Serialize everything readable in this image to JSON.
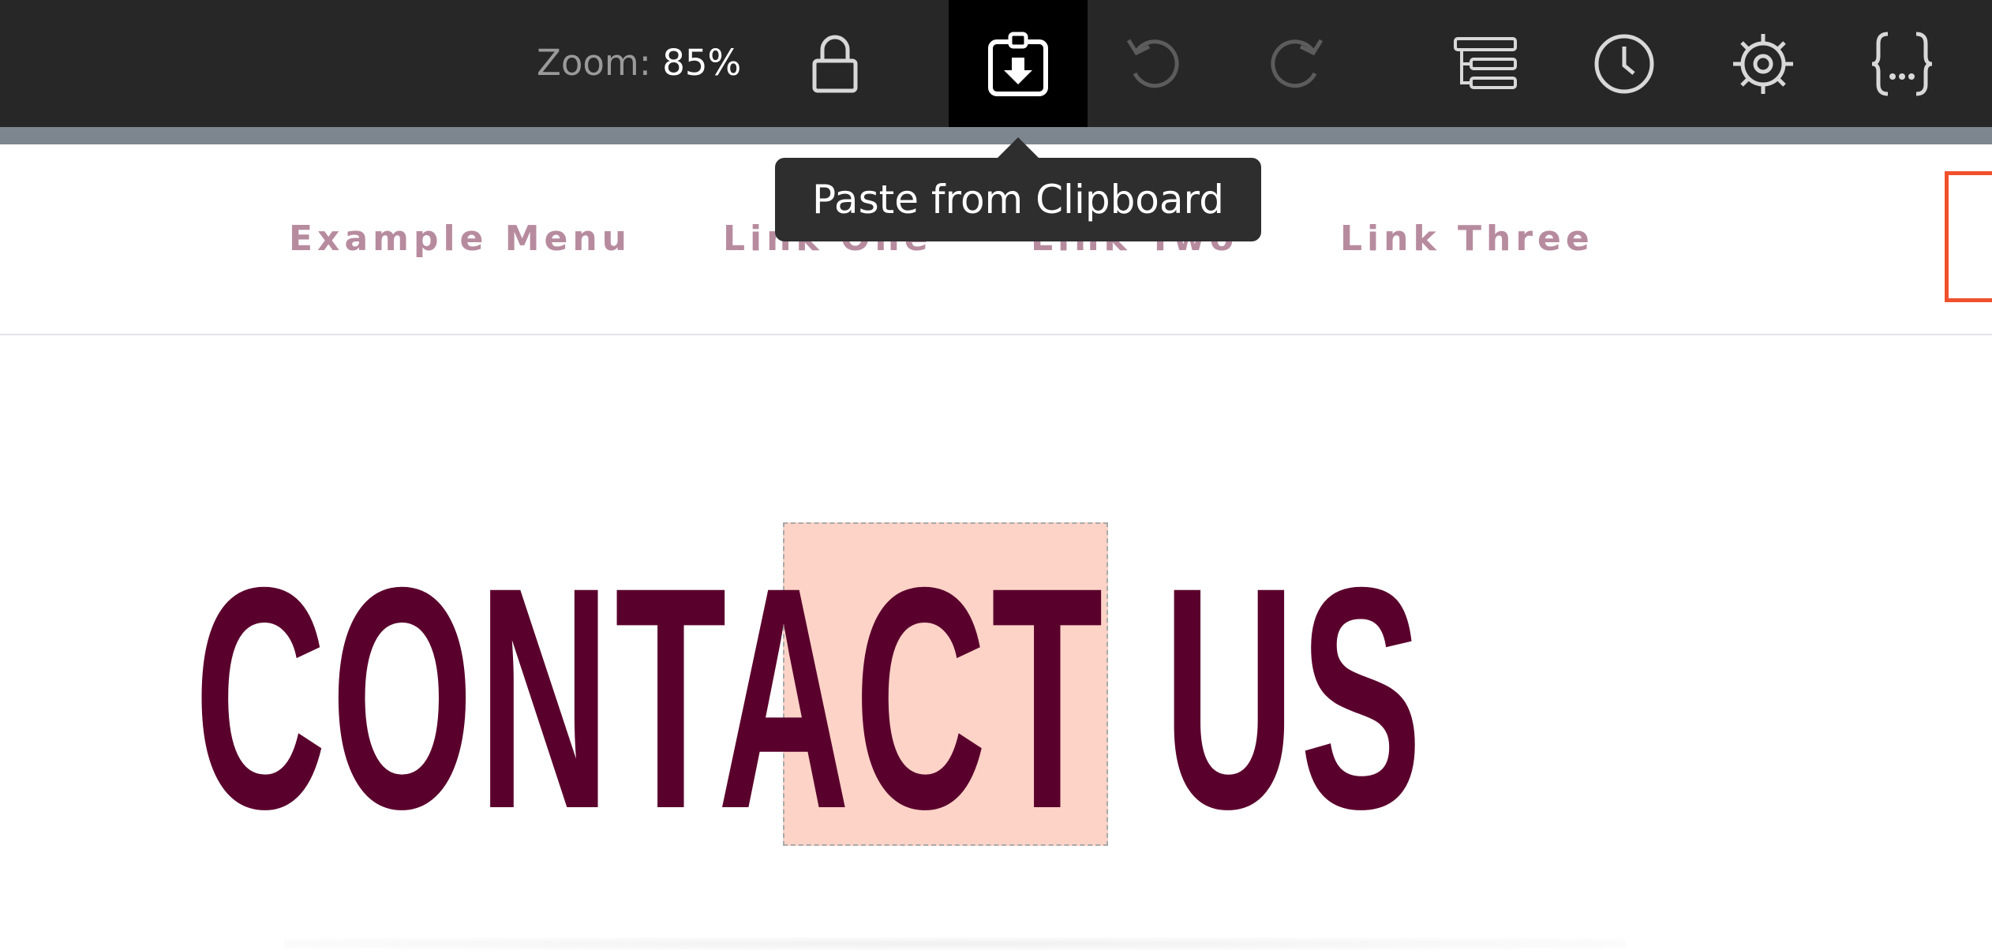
{
  "toolbar": {
    "zoom_label": "Zoom:",
    "zoom_value": "85%",
    "icons": [
      "lock-icon",
      "paste-clipboard-icon",
      "undo-icon",
      "redo-icon",
      "navigator-icon",
      "history-icon",
      "settings-icon",
      "code-icon"
    ]
  },
  "tooltip": {
    "text": "Paste from Clipboard"
  },
  "nav": {
    "items": [
      "Example Menu",
      "Link One",
      "Link Two",
      "Link Three"
    ],
    "color": "#b78b9e",
    "cta_border_color": "#f0512c"
  },
  "heading": {
    "text": "CONTACT US",
    "color": "#5a002c",
    "selection_color": "#fdd3c7"
  }
}
